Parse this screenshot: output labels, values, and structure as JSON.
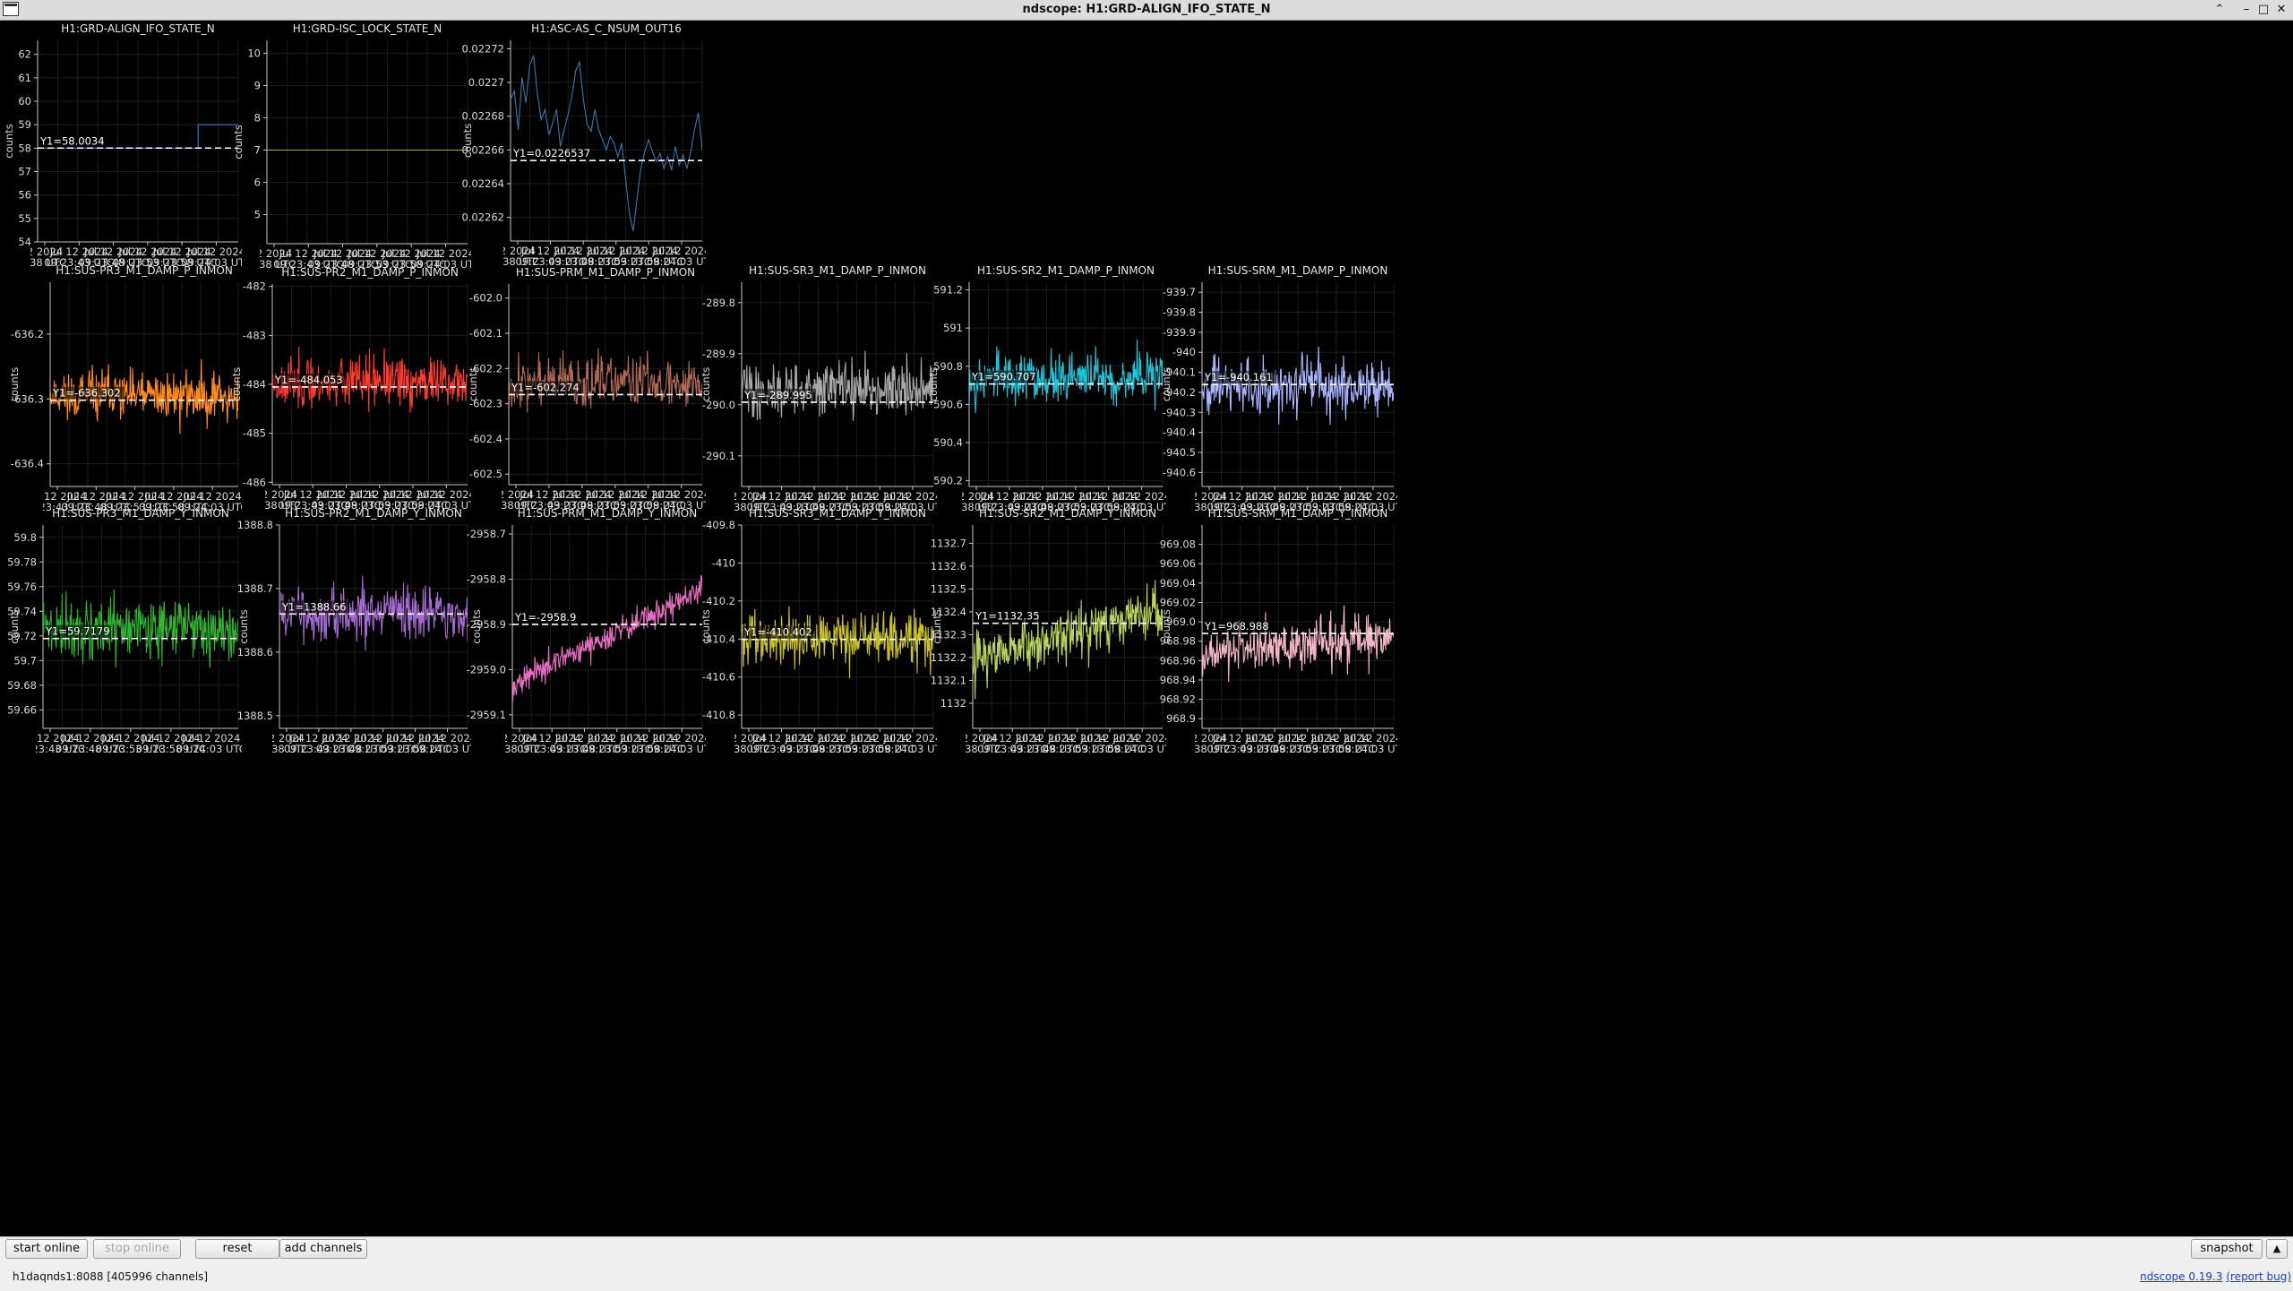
{
  "window": {
    "title": "ndscope: H1:GRD-ALIGN_IFO_STATE_N",
    "controls": {
      "up": "⌃",
      "minimize": "–",
      "maximize": "□",
      "close": "✕"
    }
  },
  "toolbar": {
    "start_online": "start online",
    "stop_online": "stop online",
    "reset": "reset",
    "add_channels": "add channels",
    "snapshot": "snapshot",
    "expand": "▲"
  },
  "status": {
    "server": "h1daqnds1:8088",
    "channel_count": "[405996 channels]",
    "app_link": "ndscope 0.19.3",
    "report_bug": "(report bug)"
  },
  "ylabel": "counts",
  "chart_data": [
    {
      "type": "line",
      "title": "H1:GRD-ALIGN_IFO_STATE_N",
      "color": "#3d7bd4",
      "ylim": [
        54,
        62.6
      ],
      "yticks": [
        "54",
        "55",
        "56",
        "57",
        "58",
        "59",
        "60",
        "61",
        "62"
      ],
      "cursor_label": "Y1=58.0034",
      "cursor_y": 58.0034,
      "series": [
        {
          "x": [
            0,
            0.8,
            0.8,
            1
          ],
          "y": [
            58.0,
            58.0,
            59.0,
            59.0
          ]
        }
      ],
      "xticks": [
        "2 2024",
        "Jul 12 2024",
        "Jul 12 2024",
        "Jul 12 2024",
        "Jul 12 2024",
        "Jul 12 2024"
      ],
      "xticks2": [
        "I:38 UTC",
        "09:23:43 UTC",
        "09:23:48 UTC",
        "09:23:53 UTC",
        "09:23:58 UTC",
        "09:24:03 UTC"
      ]
    },
    {
      "type": "line",
      "title": "H1:GRD-ISC_LOCK_STATE_N",
      "color": "#a8ae3a",
      "ylim": [
        4.1,
        10.4
      ],
      "yticks": [
        "5",
        "6",
        "7",
        "8",
        "9",
        "10"
      ],
      "cursor_label": "",
      "series": [
        {
          "x": [
            0,
            1
          ],
          "y": [
            7,
            7
          ]
        }
      ],
      "xticks": [
        "2 2024",
        "Jul 12 2024",
        "Jul 12 2024",
        "Jul 12 2024",
        "Jul 12 2024",
        "Jul 12 2024"
      ],
      "xticks2": [
        "I:38 UTC",
        "09:23:43 UTC",
        "09:23:48 UTC",
        "09:23:53 UTC",
        "09:23:58 UTC",
        "09:24:03 UTC"
      ]
    },
    {
      "type": "line",
      "title": "H1:ASC-AS_C_NSUM_OUT16",
      "color": "#3a78a8",
      "ylim": [
        0.022606,
        0.022725
      ],
      "yticks": [
        "0.02262",
        "0.02264",
        "0.02266",
        "0.02268",
        "0.0227",
        "0.02272"
      ],
      "cursor_label": "Y1=0.0226537",
      "cursor_y": 0.0226537,
      "series": [
        {
          "x": [
            0,
            0.02,
            0.04,
            0.06,
            0.08,
            0.1,
            0.12,
            0.14,
            0.16,
            0.18,
            0.2,
            0.22,
            0.24,
            0.26,
            0.28,
            0.3,
            0.32,
            0.34,
            0.36,
            0.38,
            0.4,
            0.42,
            0.44,
            0.46,
            0.48,
            0.5,
            0.52,
            0.54,
            0.56,
            0.58,
            0.6,
            0.62,
            0.64,
            0.66,
            0.68,
            0.7,
            0.72,
            0.74,
            0.76,
            0.78,
            0.8,
            0.82,
            0.84,
            0.86,
            0.88,
            0.9,
            0.92,
            0.94,
            0.96,
            0.98,
            1
          ],
          "y": [
            0.02269,
            0.022695,
            0.022672,
            0.022703,
            0.022688,
            0.02271,
            0.022716,
            0.022693,
            0.022678,
            0.022684,
            0.022669,
            0.022676,
            0.022684,
            0.022662,
            0.022672,
            0.022681,
            0.022692,
            0.022707,
            0.022712,
            0.02269,
            0.022675,
            0.022671,
            0.022684,
            0.022672,
            0.022666,
            0.02266,
            0.022668,
            0.022664,
            0.022656,
            0.022664,
            0.022643,
            0.022622,
            0.022612,
            0.022631,
            0.022649,
            0.022659,
            0.022666,
            0.022659,
            0.022653,
            0.022658,
            0.022649,
            0.022656,
            0.022648,
            0.022662,
            0.022651,
            0.022657,
            0.022649,
            0.022659,
            0.022672,
            0.022682,
            0.02266
          ]
        }
      ],
      "xticks": [
        "2 2024",
        "Jul 12 2024",
        "Jul 12 2024",
        "Jul 12 2024",
        "Jul 12 2024",
        "Jul 12 2024"
      ],
      "xticks2": [
        "I:38 UTC",
        "09:23:43 UTC",
        "09:23:48 UTC",
        "09:23:53 UTC",
        "09:23:58 UTC",
        "09:24:03 UTC"
      ]
    },
    {
      "type": "line",
      "title": "H1:SUS-PR3_M1_DAMP_P_INMON",
      "color": "#ff8c1a",
      "ylim": [
        -636.435,
        -636.12
      ],
      "yticks": [
        "-636.4",
        "-636.3",
        "-636.2"
      ],
      "cursor_label": "Y1=-636.302",
      "cursor_y": -636.302,
      "noise": {
        "center": -636.295,
        "amp": 0.055,
        "trend": 0,
        "seed": 11
      },
      "xticks": [
        "Jul 12 2024",
        "Jul 12 2024",
        "Jul 12 2024",
        "Jul 12 2024",
        "Jul 12 2024"
      ],
      "xticks2": [
        "09:23:43 UTC",
        "09:23:48 UTC",
        "09:23:53 UTC",
        "09:23:58 UTC",
        "09:24:03 UTC"
      ]
    },
    {
      "type": "line",
      "title": "H1:SUS-PR2_M1_DAMP_P_INMON",
      "color": "#ff3b30",
      "ylim": [
        -486.05,
        -481.95
      ],
      "yticks": [
        "-486",
        "-485",
        "-484",
        "-483",
        "-482"
      ],
      "cursor_label": "Y1=-484.053",
      "cursor_y": -484.053,
      "noise": {
        "center": -483.95,
        "amp": 0.75,
        "trend": 0,
        "seed": 23
      },
      "xticks": [
        "2 2024",
        "Jul 12 2024",
        "Jul 12 2024",
        "Jul 12 2024",
        "Jul 12 2024",
        "Jul 12 2024"
      ],
      "xticks2": [
        "I:38 UTC",
        "09:23:43 UTC",
        "09:23:48 UTC",
        "09:23:53 UTC",
        "09:23:58 UTC",
        "09:24:03 UTC"
      ]
    },
    {
      "type": "line",
      "title": "H1:SUS-PRM_M1_DAMP_P_INMON",
      "color": "#b06a54",
      "ylim": [
        -602.53,
        -601.96
      ],
      "yticks": [
        "-602.5",
        "-602.4",
        "-602.3",
        "-602.2",
        "-602.1",
        "-602.0"
      ],
      "cursor_label": "Y1=-602.274",
      "cursor_y": -602.274,
      "noise": {
        "center": -602.24,
        "amp": 0.1,
        "trend": 0,
        "seed": 37
      },
      "xticks": [
        "2 2024",
        "Jul 12 2024",
        "Jul 12 2024",
        "Jul 12 2024",
        "Jul 12 2024",
        "Jul 12 2024"
      ],
      "xticks2": [
        "I:38 UTC",
        "09:23:43 UTC",
        "09:23:48 UTC",
        "09:23:53 UTC",
        "09:23:58 UTC",
        "09:24:03 UTC"
      ]
    },
    {
      "type": "line",
      "title": "H1:SUS-SR3_M1_DAMP_P_INMON",
      "color": "#a9a9a9",
      "ylim": [
        -290.16,
        -289.76
      ],
      "yticks": [
        "-290.1",
        "-290.0",
        "-289.9",
        "-289.8"
      ],
      "cursor_label": "Y1=-289.995",
      "cursor_y": -289.995,
      "noise": {
        "center": -289.97,
        "amp": 0.075,
        "trend": 0,
        "seed": 41
      },
      "xticks": [
        "2 2024",
        "Jul 12 2024",
        "Jul 12 2024",
        "Jul 12 2024",
        "Jul 12 2024",
        "Jul 12 2024"
      ],
      "xticks2": [
        "I:38 UTC",
        "09:23:43 UTC",
        "09:23:48 UTC",
        "09:23:53 UTC",
        "09:23:58 UTC",
        "09:24:03 UTC"
      ]
    },
    {
      "type": "line",
      "title": "H1:SUS-SR2_M1_DAMP_P_INMON",
      "color": "#1fc2d6",
      "ylim": [
        590.17,
        591.24
      ],
      "yticks": [
        "590.2",
        "590.4",
        "590.6",
        "590.8",
        "591",
        "591.2"
      ],
      "cursor_label": "Y1=590.707",
      "cursor_y": 590.707,
      "noise": {
        "center": 590.74,
        "amp": 0.2,
        "trend": 0,
        "seed": 53
      },
      "xticks": [
        "2 2024",
        "Jul 12 2024",
        "Jul 12 2024",
        "Jul 12 2024",
        "Jul 12 2024",
        "Jul 12 2024"
      ],
      "xticks2": [
        "I:38 UTC",
        "09:23:43 UTC",
        "09:23:48 UTC",
        "09:23:53 UTC",
        "09:23:58 UTC",
        "09:24:03 UTC"
      ]
    },
    {
      "type": "line",
      "title": "H1:SUS-SRM_M1_DAMP_P_INMON",
      "color": "#a9b6ff",
      "ylim": [
        -940.67,
        -939.65
      ],
      "yticks": [
        "-940.6",
        "-940.5",
        "-940.4",
        "-940.3",
        "-940.2",
        "-940.1",
        "-940",
        "-939.9",
        "-939.8",
        "-939.7"
      ],
      "cursor_label": "Y1=-940.161",
      "cursor_y": -940.161,
      "noise": {
        "center": -940.16,
        "amp": 0.2,
        "trend": 0,
        "seed": 67
      },
      "xticks": [
        "2 2024",
        "Jul 12 2024",
        "Jul 12 2024",
        "Jul 12 2024",
        "Jul 12 2024",
        "Jul 12 2024"
      ],
      "xticks2": [
        "I:38 UTC",
        "09:23:43 UTC",
        "09:23:48 UTC",
        "09:23:53 UTC",
        "09:23:58 UTC",
        "09:24:03 UTC"
      ]
    },
    {
      "type": "line",
      "title": "H1:SUS-PR3_M1_DAMP_Y_INMON",
      "color": "#2fb82f",
      "ylim": [
        59.645,
        59.81
      ],
      "yticks": [
        "59.66",
        "59.68",
        "59.7",
        "59.72",
        "59.74",
        "59.76",
        "59.78",
        "59.8"
      ],
      "cursor_label": "Y1=59.7179",
      "cursor_y": 59.7179,
      "noise": {
        "center": 59.725,
        "amp": 0.035,
        "trend": 0,
        "seed": 71
      },
      "xticks": [
        "Jul 12 2024",
        "Jul 12 2024",
        "Jul 12 2024",
        "Jul 12 2024",
        "Jul 12 2024"
      ],
      "xticks2": [
        "09:23:43 UTC",
        "09:23:48 UTC",
        "09:23:53 UTC",
        "09:23:58 UTC",
        "09:24:03 UTC"
      ]
    },
    {
      "type": "line",
      "title": "H1:SUS-PR2_M1_DAMP_Y_INMON",
      "color": "#a66bd1",
      "ylim": [
        1388.48,
        1388.8
      ],
      "yticks": [
        "1388.5",
        "1388.6",
        "1388.7",
        "1388.8"
      ],
      "cursor_label": "Y1=1388.66",
      "cursor_y": 1388.66,
      "noise": {
        "center": 1388.66,
        "amp": 0.06,
        "trend": 0,
        "seed": 83
      },
      "xticks": [
        "2 2024",
        "Jul 12 2024",
        "Jul 12 2024",
        "Jul 12 2024",
        "Jul 12 2024",
        "Jul 12 2024"
      ],
      "xticks2": [
        "I:38 UTC",
        "09:23:43 UTC",
        "09:23:48 UTC",
        "09:23:53 UTC",
        "09:23:58 UTC",
        "09:24:03 UTC"
      ]
    },
    {
      "type": "line",
      "title": "H1:SUS-PRM_M1_DAMP_Y_INMON",
      "color": "#e56cc1",
      "ylim": [
        -2959.13,
        -2958.68
      ],
      "yticks": [
        "-2959.1",
        "-2959.0",
        "-2958.9",
        "-2958.8",
        "-2958.7"
      ],
      "cursor_label": "Y1=-2958.9",
      "cursor_y": -2958.9,
      "noise": {
        "center": -2958.93,
        "amp": 0.045,
        "trend": 0.23,
        "seed": 97
      },
      "xticks": [
        "2 2024",
        "Jul 12 2024",
        "Jul 12 2024",
        "Jul 12 2024",
        "Jul 12 2024",
        "Jul 12 2024"
      ],
      "xticks2": [
        "I:38 UTC",
        "09:23:43 UTC",
        "09:23:48 UTC",
        "09:23:53 UTC",
        "09:23:58 UTC",
        "09:24:03 UTC"
      ]
    },
    {
      "type": "line",
      "title": "H1:SUS-SR3_M1_DAMP_Y_INMON",
      "color": "#c9c224",
      "ylim": [
        -410.87,
        -409.8
      ],
      "yticks": [
        "-410.8",
        "-410.6",
        "-410.4",
        "-410.2",
        "-410",
        "-409.8"
      ],
      "cursor_label": "Y1=-410.402",
      "cursor_y": -410.402,
      "noise": {
        "center": -410.39,
        "amp": 0.2,
        "trend": 0,
        "seed": 101
      },
      "xticks": [
        "2 2024",
        "Jul 12 2024",
        "Jul 12 2024",
        "Jul 12 2024",
        "Jul 12 2024",
        "Jul 12 2024"
      ],
      "xticks2": [
        "I:38 UTC",
        "09:23:43 UTC",
        "09:23:48 UTC",
        "09:23:53 UTC",
        "09:23:58 UTC",
        "09:24:03 UTC"
      ]
    },
    {
      "type": "line",
      "title": "H1:SUS-SR2_M1_DAMP_Y_INMON",
      "color": "#b8d45a",
      "ylim": [
        1131.89,
        1132.78
      ],
      "yticks": [
        "1132",
        "1132.1",
        "1132.2",
        "1132.3",
        "1132.4",
        "1132.5",
        "1132.6",
        "1132.7"
      ],
      "cursor_label": "Y1=1132.35",
      "cursor_y": 1132.35,
      "noise": {
        "center": 1132.3,
        "amp": 0.17,
        "trend": 0.12,
        "seed": 113
      },
      "xticks": [
        "2 2024",
        "Jul 12 2024",
        "Jul 12 2024",
        "Jul 12 2024",
        "Jul 12 2024",
        "Jul 12 2024"
      ],
      "xticks2": [
        "I:38 UTC",
        "09:23:43 UTC",
        "09:23:48 UTC",
        "09:23:53 UTC",
        "09:23:58 UTC",
        "09:24:03 UTC"
      ]
    },
    {
      "type": "line",
      "title": "H1:SUS-SRM_M1_DAMP_Y_INMON",
      "color": "#f2b7c7",
      "ylim": [
        968.89,
        969.1
      ],
      "yticks": [
        "968.9",
        "968.92",
        "968.94",
        "968.96",
        "968.98",
        "969.0",
        "969.02",
        "969.04",
        "969.06",
        "969.08"
      ],
      "cursor_label": "Y1=968.988",
      "cursor_y": 968.988,
      "noise": {
        "center": 968.975,
        "amp": 0.035,
        "trend": 0.035,
        "seed": 127
      },
      "xticks": [
        "2 2024",
        "Jul 12 2024",
        "Jul 12 2024",
        "Jul 12 2024",
        "Jul 12 2024",
        "Jul 12 2024"
      ],
      "xticks2": [
        "I:38 UTC",
        "09:23:43 UTC",
        "09:23:48 UTC",
        "09:23:53 UTC",
        "09:23:58 UTC",
        "09:24:03 UTC"
      ]
    }
  ]
}
